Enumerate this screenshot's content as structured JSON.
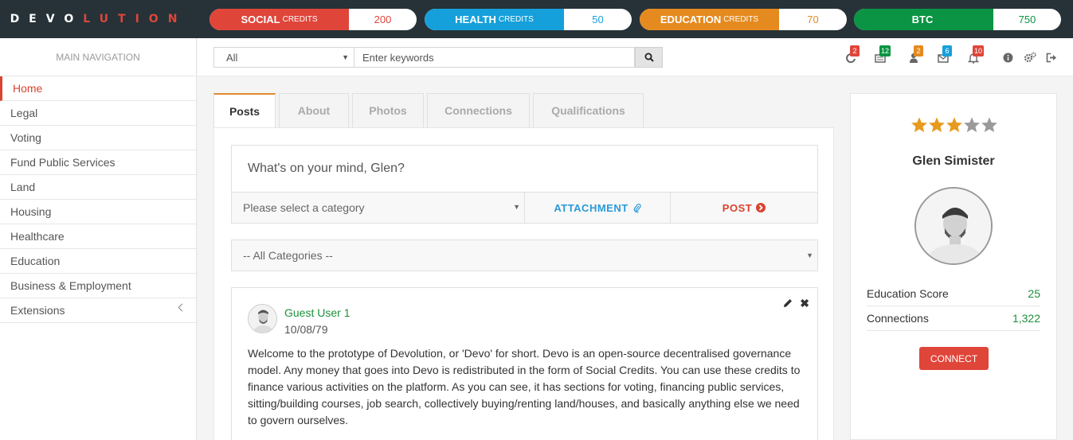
{
  "logo": {
    "part1": "DEVO",
    "part2": "LUTION"
  },
  "credits": [
    {
      "label": "SOCIAL",
      "suffix": "CREDITS",
      "value": "200",
      "color": "#e0453a",
      "value_color": "#e0453a"
    },
    {
      "label": "HEALTH",
      "suffix": "CREDITS",
      "value": "50",
      "color": "#16a0db",
      "value_color": "#16a0db"
    },
    {
      "label": "EDUCATION",
      "suffix": "CREDITS",
      "value": "70",
      "color": "#e58a1f",
      "value_color": "#e58a1f"
    },
    {
      "label": "BTC",
      "suffix": "",
      "value": "750",
      "color": "#0a9443",
      "value_color": "#0a9443"
    }
  ],
  "sidebar": {
    "header": "MAIN NAVIGATION",
    "items": [
      {
        "label": "Home"
      },
      {
        "label": "Legal"
      },
      {
        "label": "Voting"
      },
      {
        "label": "Fund Public Services"
      },
      {
        "label": "Land"
      },
      {
        "label": "Housing"
      },
      {
        "label": "Healthcare"
      },
      {
        "label": "Education"
      },
      {
        "label": "Business & Employment"
      },
      {
        "label": "Extensions"
      }
    ]
  },
  "search": {
    "scope": "All",
    "placeholder": "Enter keywords"
  },
  "notifications": [
    {
      "icon": "refresh-icon",
      "count": "2",
      "color": "#e0453a"
    },
    {
      "icon": "newspaper-icon",
      "count": "12",
      "color": "#0a9443"
    },
    {
      "icon": "user-icon",
      "count": "2",
      "color": "#e58a1f"
    },
    {
      "icon": "envelope-icon",
      "count": "6",
      "color": "#16a0db"
    },
    {
      "icon": "bell-icon",
      "count": "10",
      "color": "#e0453a"
    }
  ],
  "tabs": [
    "Posts",
    "About",
    "Photos",
    "Connections",
    "Qualifications"
  ],
  "composer": {
    "prompt": "What's on your mind, Glen?",
    "category_placeholder": "Please select a category",
    "attachment": "ATTACHMENT",
    "post": "POST"
  },
  "filter": {
    "value": "-- All Categories --"
  },
  "post": {
    "author": "Guest User 1",
    "date": "10/08/79",
    "body": "Welcome to the prototype of Devolution, or 'Devo' for short. Devo is an open-source decentralised governance model. Any money that goes into Devo is redistributed in the form of Social Credits. You can use these credits to finance various activities on the platform. As you can see, it has sections for voting, financing public services, sitting/building courses, job search, collectively buying/renting land/houses, and basically anything else we need to govern ourselves."
  },
  "profile": {
    "rating": 3,
    "rating_max": 5,
    "name": "Glen Simister",
    "stats": [
      {
        "label": "Education Score",
        "value": "25"
      },
      {
        "label": "Connections",
        "value": "1,322"
      }
    ],
    "connect": "CONNECT"
  }
}
